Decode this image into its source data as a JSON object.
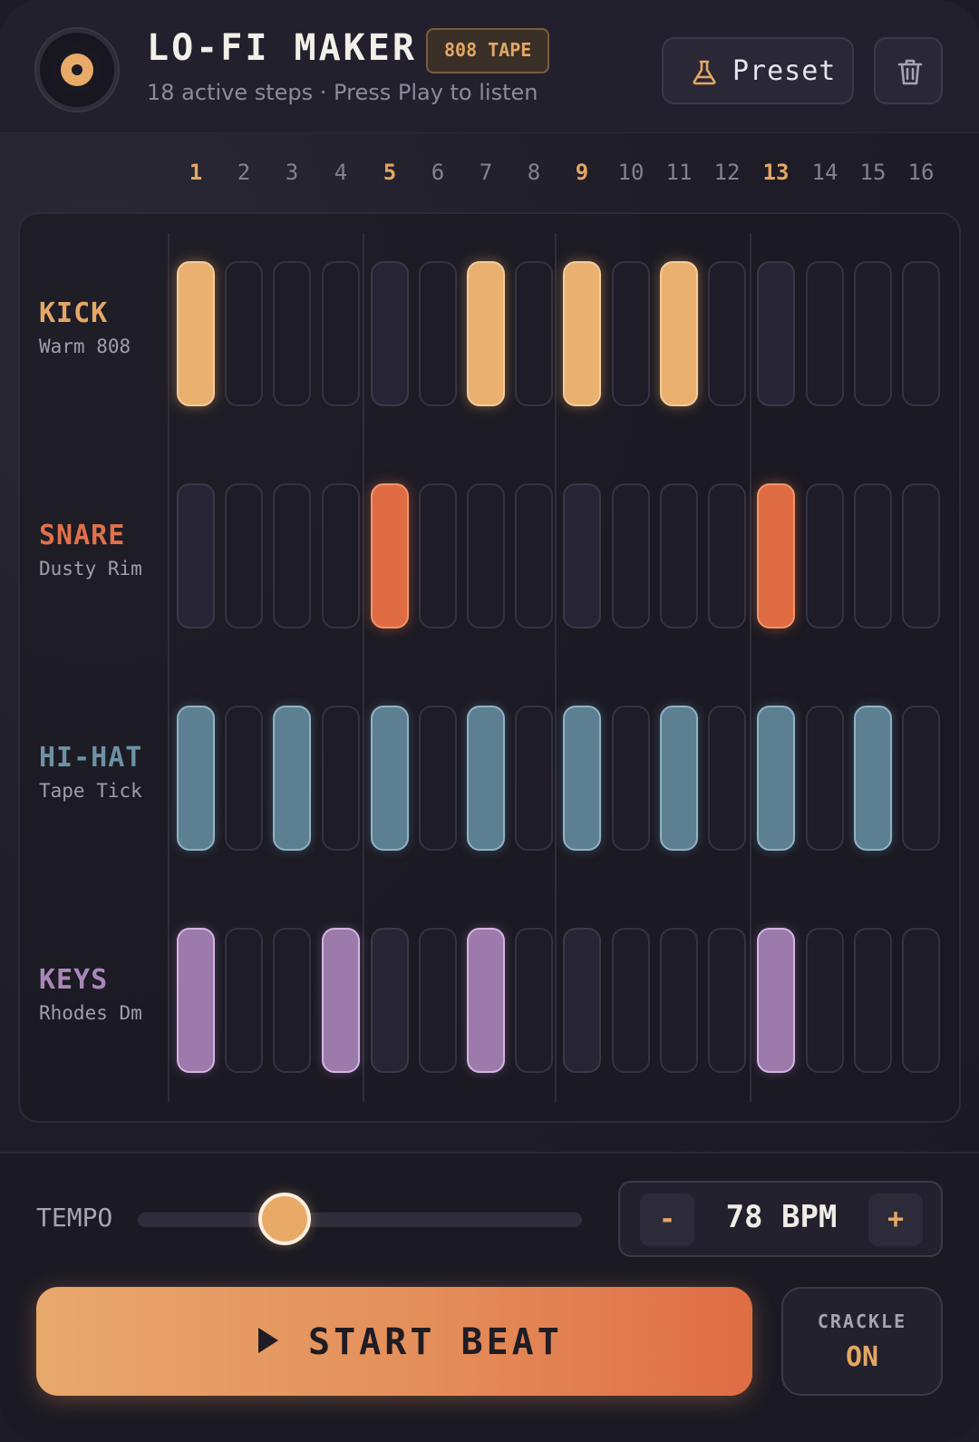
{
  "header": {
    "title": "LO-FI MAKER",
    "badge": "808 TAPE",
    "subtitle": "18 active steps · Press Play to listen",
    "preset_label": "Preset"
  },
  "step_numbers": [
    "1",
    "2",
    "3",
    "4",
    "5",
    "6",
    "7",
    "8",
    "9",
    "10",
    "11",
    "12",
    "13",
    "14",
    "15",
    "16"
  ],
  "accent_steps": [
    1,
    5,
    9,
    13
  ],
  "tracks": [
    {
      "name": "KICK",
      "sub": "Warm 808",
      "kind": "kick",
      "color": "#e5a765",
      "steps": [
        1,
        0,
        0,
        0,
        0,
        0,
        1,
        0,
        1,
        0,
        1,
        0,
        0,
        0,
        0,
        0
      ]
    },
    {
      "name": "SNARE",
      "sub": "Dusty Rim",
      "kind": "snare",
      "color": "#e0714a",
      "steps": [
        0,
        0,
        0,
        0,
        1,
        0,
        0,
        0,
        0,
        0,
        0,
        0,
        1,
        0,
        0,
        0
      ]
    },
    {
      "name": "HI-HAT",
      "sub": "Tape Tick",
      "kind": "hihat",
      "color": "#6d91a4",
      "steps": [
        1,
        0,
        1,
        0,
        1,
        0,
        1,
        0,
        1,
        0,
        1,
        0,
        1,
        0,
        1,
        0
      ]
    },
    {
      "name": "KEYS",
      "sub": "Rhodes Dm",
      "kind": "keys",
      "color": "#a987b8",
      "steps": [
        1,
        0,
        0,
        1,
        0,
        0,
        1,
        0,
        0,
        0,
        0,
        0,
        1,
        0,
        0,
        0
      ]
    }
  ],
  "tempo": {
    "label": "TEMPO",
    "value_fraction": 0.33,
    "bpm_text": "78 BPM",
    "minus": "-",
    "plus": "+"
  },
  "controls": {
    "start_label": "START BEAT",
    "crackle_label": "CRACKLE",
    "crackle_state": "ON"
  }
}
